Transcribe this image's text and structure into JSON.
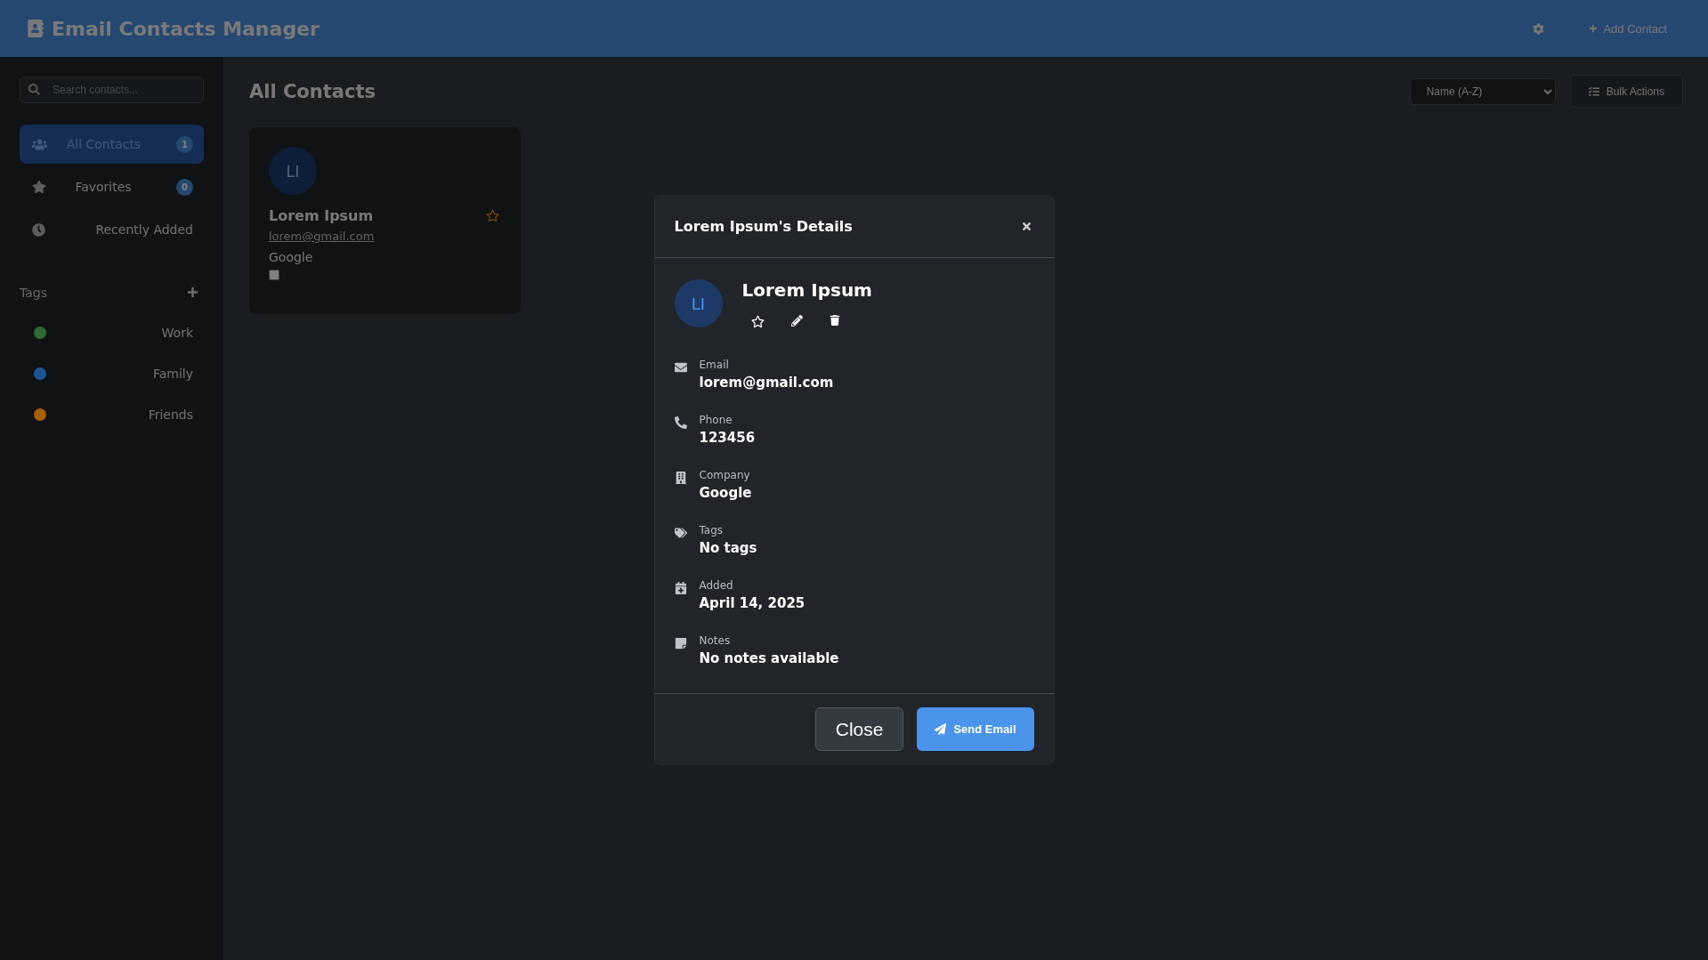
{
  "header": {
    "title": "Email Contacts Manager",
    "add_button": "Add Contact"
  },
  "sidebar": {
    "search": {
      "placeholder": "Search contacts..."
    },
    "nav": [
      {
        "kind": "all",
        "label": "All Contacts",
        "count": "1",
        "selected": true
      },
      {
        "kind": "favorites",
        "label": "Favorites",
        "count": "0",
        "selected": false
      },
      {
        "kind": "recent",
        "label": "Recently Added",
        "selected": false
      }
    ],
    "tags_heading": "Tags",
    "tags": [
      {
        "label": "Work",
        "color": "#2f6b34"
      },
      {
        "label": "Family",
        "color": "#1a5694"
      },
      {
        "label": "Friends",
        "color": "#a8600c"
      }
    ]
  },
  "main": {
    "title": "All Contacts",
    "sort": "Name (A-Z)",
    "bulk_button": "Bulk Actions",
    "contacts": [
      {
        "initials": "LI",
        "name": "Lorem Ipsum",
        "email": "lorem@gmail.com",
        "company": "Google",
        "favorite": false,
        "checked": false
      }
    ]
  },
  "modal": {
    "title": "Lorem Ipsum's Details",
    "initials": "LI",
    "name": "Lorem Ipsum",
    "favorite": false,
    "fields": [
      {
        "kind": "email",
        "label": "Email",
        "value": "lorem@gmail.com"
      },
      {
        "kind": "phone",
        "label": "Phone",
        "value": "123456"
      },
      {
        "kind": "company",
        "label": "Company",
        "value": "Google"
      },
      {
        "kind": "tags",
        "label": "Tags",
        "value": "No tags"
      },
      {
        "kind": "added",
        "label": "Added",
        "value": "April 14, 2025"
      },
      {
        "kind": "notes",
        "label": "Notes",
        "value": "No notes available"
      }
    ],
    "close_button": "Close",
    "send_button": "Send Email"
  }
}
